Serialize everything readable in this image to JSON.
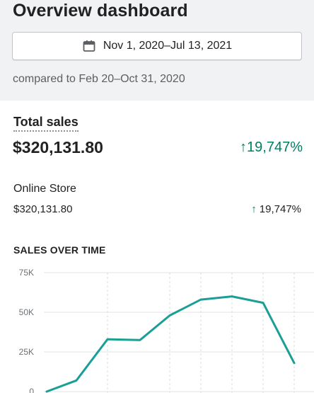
{
  "header": {
    "title": "Overview dashboard",
    "date_range": "Nov 1, 2020–Jul 13, 2021",
    "compare": "compared to Feb 20–Oct 31, 2020"
  },
  "total_sales": {
    "label": "Total sales",
    "value": "$320,131.80",
    "change": "↑19,747%"
  },
  "online_store": {
    "label": "Online Store",
    "value": "$320,131.80",
    "change_arrow": "↑",
    "change": "19,747%"
  },
  "colors": {
    "accent": "#008060",
    "line": "#1a9e96",
    "background_top": "#f1f2f3"
  },
  "chart_data": {
    "type": "line",
    "title": "SALES OVER TIME",
    "y_ticks": [
      "75K",
      "50K",
      "25K",
      "0"
    ],
    "ylim": [
      0,
      80000
    ],
    "series": [
      {
        "values": [
          0,
          7000,
          33000,
          32500,
          48000,
          58000,
          60000,
          56000,
          18000
        ]
      }
    ],
    "grid": true
  }
}
